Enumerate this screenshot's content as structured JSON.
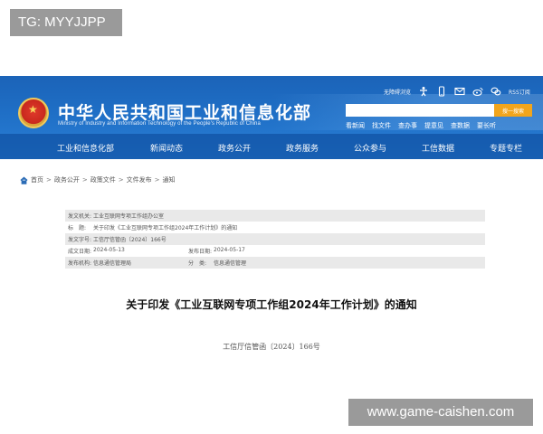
{
  "tag_badge": "TG: MYYJJPP",
  "watermark": "www.game-caishen.com",
  "header": {
    "title": "中华人民共和国工业和信息化部",
    "subtitle": "Ministry of Industry and Information Technology of the People's Republic of China",
    "accessibility": "无障碍浏览",
    "rss": "RSS订阅",
    "search": {
      "placeholder": "",
      "button": "搜一搜索"
    },
    "hot_links": [
      "看新闻",
      "找文件",
      "查办事",
      "提意见",
      "查数据",
      "要长听"
    ],
    "accent_color": "#1f6fc6"
  },
  "nav": {
    "items": [
      "工业和信息化部",
      "新闻动态",
      "政务公开",
      "政务服务",
      "公众参与",
      "工信数据",
      "专题专栏"
    ]
  },
  "breadcrumb": [
    "首页",
    "政务公开",
    "政策文件",
    "文件发布",
    "通知"
  ],
  "meta": {
    "issuer_label": "发文机关:",
    "issuer_value": "工业互联网专项工作组办公室",
    "title_label": "标　题:",
    "title_value": "关于印发《工业互联网专项工作组2024年工作计划》的通知",
    "doc_no_label": "发文字号:",
    "doc_no_value": "工信厅信管函〔2024〕166号",
    "date_label": "成文日期:",
    "date_value": "2024-05-13",
    "publish_label": "发布日期:",
    "publish_value": "2024-05-17",
    "org_label": "发布机构:",
    "org_value": "信息通信管理局",
    "category_label": "分　类:",
    "category_value": "信息通信管理"
  },
  "document": {
    "title": "关于印发《工业互联网专项工作组2024年工作计划》的通知",
    "number": "工信厅信管函〔2024〕166号"
  }
}
